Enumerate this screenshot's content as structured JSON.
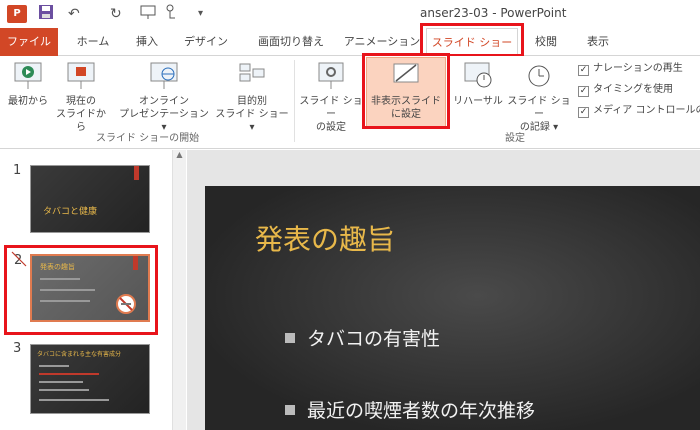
{
  "window": {
    "title": "anser23-03 - PowerPoint",
    "app_icon": "P"
  },
  "quick_access": {
    "undo": "↶",
    "redo": "↻",
    "more": "▾"
  },
  "tabs": [
    {
      "label": "ファイル"
    },
    {
      "label": "ホーム"
    },
    {
      "label": "挿入"
    },
    {
      "label": "デザイン"
    },
    {
      "label": "画面切り替え"
    },
    {
      "label": "アニメーション"
    },
    {
      "label": "スライド ショー"
    },
    {
      "label": "校閲"
    },
    {
      "label": "表示"
    }
  ],
  "ribbon": {
    "start_group": {
      "label": "スライド ショーの開始",
      "buttons": [
        {
          "line1": "最初から",
          "line2": ""
        },
        {
          "line1": "現在の",
          "line2": "スライドから"
        },
        {
          "line1": "オンライン",
          "line2": "プレゼンテーション ▾"
        },
        {
          "line1": "目的別",
          "line2": "スライド ショー ▾"
        }
      ]
    },
    "setup_group": {
      "label": "設定",
      "buttons": [
        {
          "line1": "スライド ショー",
          "line2": "の設定"
        },
        {
          "line1": "非表示スライド",
          "line2": "に設定"
        },
        {
          "line1": "リハーサル",
          "line2": ""
        },
        {
          "line1": "スライド ショー",
          "line2": "の記録 ▾"
        }
      ],
      "checkboxes": [
        {
          "label": "ナレーションの再生",
          "checked": true
        },
        {
          "label": "タイミングを使用",
          "checked": true
        },
        {
          "label": "メディア コントロールの表",
          "checked": true
        }
      ]
    }
  },
  "slides_panel": {
    "slides": [
      {
        "number": "1",
        "title": "タバコと健康"
      },
      {
        "number": "2",
        "title": "発表の趣旨"
      },
      {
        "number": "3",
        "title": "タバコに含まれる主な有害成分"
      }
    ]
  },
  "current_slide": {
    "title": "発表の趣旨",
    "bullets": [
      "タバコの有害性",
      "最近の喫煙者数の年次推移"
    ]
  },
  "colors": {
    "accent": "#d24726",
    "highlight_red": "#e8141b",
    "title_gold": "#e8b84a"
  }
}
